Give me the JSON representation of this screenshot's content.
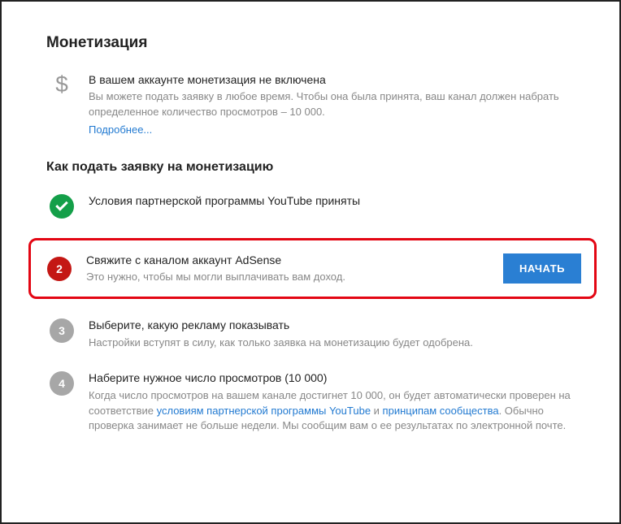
{
  "pageTitle": "Монетизация",
  "status": {
    "title": "В вашем аккаунте монетизация не включена",
    "desc": "Вы можете подать заявку в любое время. Чтобы она была принята, ваш канал должен набрать определенное количество просмотров – 10 000.",
    "learnMore": "Подробнее..."
  },
  "howToTitle": "Как подать заявку на монетизацию",
  "step1": {
    "title": "Условия партнерской программы YouTube приняты"
  },
  "step2": {
    "num": "2",
    "title": "Свяжите с каналом аккаунт AdSense",
    "desc": "Это нужно, чтобы мы могли выплачивать вам доход.",
    "button": "НАЧАТЬ"
  },
  "step3": {
    "num": "3",
    "title": "Выберите, какую рекламу показывать",
    "desc": "Настройки вступят в силу, как только заявка на монетизацию будет одобрена."
  },
  "step4": {
    "num": "4",
    "title": "Наберите нужное число просмотров (10 000)",
    "descPart1": "Когда число просмотров на вашем канале достигнет 10 000, он будет автоматически проверен на соответствие ",
    "link1": "условиям партнерской программы YouTube",
    "descPart2": " и ",
    "link2": "принципам сообщества",
    "descPart3": ". Обычно проверка занимает не больше недели. Мы сообщим вам о ее результатах по электронной почте."
  }
}
